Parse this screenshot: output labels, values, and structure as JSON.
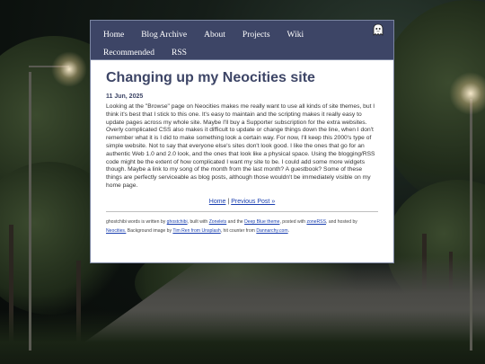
{
  "nav": {
    "row1": [
      "Home",
      "Blog Archive",
      "About",
      "Projects",
      "Wiki"
    ],
    "row2": [
      "Recommended",
      "RSS"
    ]
  },
  "post": {
    "title": "Changing up my Neocities site",
    "date": "11 Jun, 2025",
    "body": "Looking at the \"Browse\" page on Neocities makes me really want to use all kinds of site themes, but I think it's best that I stick to this one. It's easy to maintain and the scripting makes it really easy to update pages across my whole site. Maybe I'll buy a Supporter subscription for the extra websites. Overly complicated CSS also makes it difficult to update or change things down the line, when I don't remember what it is I did to make something look a certain way. For now, I'll keep this 2000's type of simple website. Not to say that everyone else's sites don't look good. I like the ones that go for an authentic Web 1.0 and 2.0 look, and the ones that look like a physical space. Using the blogging/RSS code might be the extent of how complicated I want my site to be. I could add some more widgets though. Maybe a link to my song of the month from the last month? A guestbook? Some of these things are perfectly serviceable as blog posts, although those wouldn't be immediately visible on my home page."
  },
  "postnav": {
    "home": "Home",
    "separator": " | ",
    "previous": "Previous Post »"
  },
  "footer": {
    "t1": "ghostchibi words is written by ",
    "l1": "ghostchibi",
    "t2": ", built with ",
    "l2": "Zonelets",
    "t3": " and the ",
    "l3": "Deep Blue theme",
    "t4": ", posted with ",
    "l4": "zoneRSS",
    "t5": ", and hosted by ",
    "l5": "Neocities.",
    "t6": " Background image by ",
    "l6": "Tim Ren from Unsplash",
    "t7": ", hit counter from ",
    "l7": "Dannarchy.com",
    "t8": "."
  },
  "icons": {
    "logo": "ghost-icon"
  },
  "colors": {
    "accent": "#3d4566",
    "link": "#1a3fb0"
  }
}
